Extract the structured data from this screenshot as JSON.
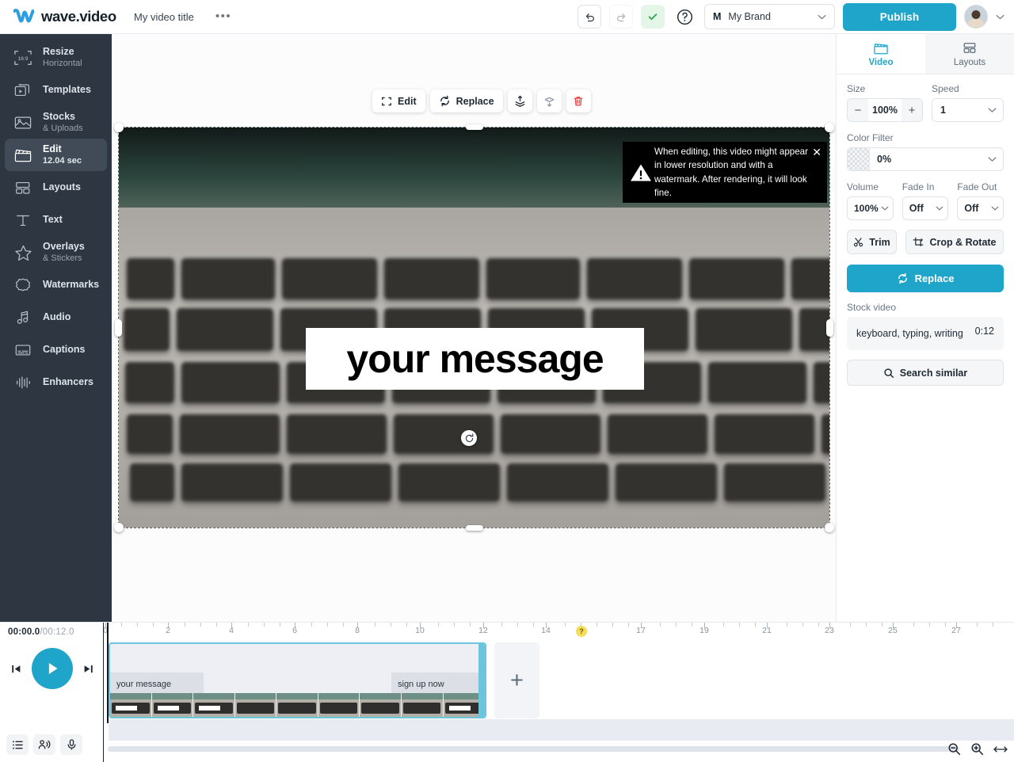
{
  "topbar": {
    "brand_name": "wave.video",
    "doc_title": "My video title",
    "more_dots": "•••",
    "undo_icon": "undo-icon",
    "redo_icon": "redo-icon",
    "saved_icon": "check-icon",
    "help_icon": "question-icon",
    "brand_letter": "M",
    "brand_label": "My Brand",
    "publish_label": "Publish"
  },
  "sidebar": {
    "items": [
      {
        "label": "Resize",
        "sub": "Horizontal",
        "icon": "resize-icon",
        "active": false
      },
      {
        "label": "Templates",
        "sub": "",
        "icon": "templates-icon",
        "active": false
      },
      {
        "label": "Stocks",
        "sub": "& Uploads",
        "icon": "image-icon",
        "active": false
      },
      {
        "label": "Edit",
        "sub": "12.04 sec",
        "icon": "clapboard-icon",
        "active": true
      },
      {
        "label": "Layouts",
        "sub": "",
        "icon": "layouts-icon",
        "active": false
      },
      {
        "label": "Text",
        "sub": "",
        "icon": "text-icon",
        "active": false
      },
      {
        "label": "Overlays",
        "sub": "& Stickers",
        "icon": "star-icon",
        "active": false
      },
      {
        "label": "Watermarks",
        "sub": "",
        "icon": "badge-icon",
        "active": false
      },
      {
        "label": "Audio",
        "sub": "",
        "icon": "music-icon",
        "active": false
      },
      {
        "label": "Captions",
        "sub": "",
        "icon": "captions-icon",
        "active": false
      },
      {
        "label": "Enhancers",
        "sub": "",
        "icon": "waveform-icon",
        "active": false
      }
    ],
    "resize_ratio": "16:9"
  },
  "canvas": {
    "toolbar": {
      "edit_label": "Edit",
      "replace_label": "Replace",
      "bring_forward_icon": "bring-forward-icon",
      "send_backward_icon": "send-backward-icon",
      "delete_icon": "trash-icon"
    },
    "overlay_text": "your message",
    "warning": {
      "icon": "warning-triangle-icon",
      "text": "When editing, this video might appear in lower resolution and with a watermark. After rendering, it will look fine.",
      "close_icon": "close-icon"
    },
    "rotate_icon": "rotate-icon"
  },
  "rightpanel": {
    "tabs": [
      {
        "label": "Video",
        "icon": "clapboard-icon",
        "active": true
      },
      {
        "label": "Layouts",
        "icon": "layouts-icon",
        "active": false
      }
    ],
    "size_label": "Size",
    "size_value": "100%",
    "size_minus": "−",
    "size_plus": "+",
    "speed_label": "Speed",
    "speed_value": "1",
    "color_filter_label": "Color Filter",
    "color_filter_value": "0%",
    "volume_label": "Volume",
    "volume_value": "100%",
    "fade_in_label": "Fade In",
    "fade_in_value": "Off",
    "fade_out_label": "Fade Out",
    "fade_out_value": "Off",
    "trim_label": "Trim",
    "crop_rotate_label": "Crop & Rotate",
    "replace_label": "Replace",
    "stock_video_label": "Stock video",
    "stock_title": "keyboard, typing, writing",
    "stock_duration": "0:12",
    "search_similar_label": "Search similar",
    "accent_color": "#1fa5c9"
  },
  "timeline": {
    "current_time": "00:00.0",
    "total_time": "/00:12.0",
    "prev_icon": "skip-previous-icon",
    "play_icon": "play-icon",
    "next_icon": "skip-next-icon",
    "tools": [
      "list-icon",
      "voiceover-icon",
      "microphone-icon"
    ],
    "ruler_labels": [
      "0",
      "2",
      "4",
      "6",
      "8",
      "10",
      "12",
      "14",
      "17",
      "19",
      "21",
      "23",
      "25",
      "27"
    ],
    "ruler_badge": "?",
    "clip": {
      "text_segments": [
        "your message",
        "sign up now"
      ],
      "add_label": "+"
    },
    "zoom_out_icon": "zoom-out-icon",
    "zoom_in_icon": "zoom-in-icon",
    "fit_icon": "fit-width-icon"
  }
}
